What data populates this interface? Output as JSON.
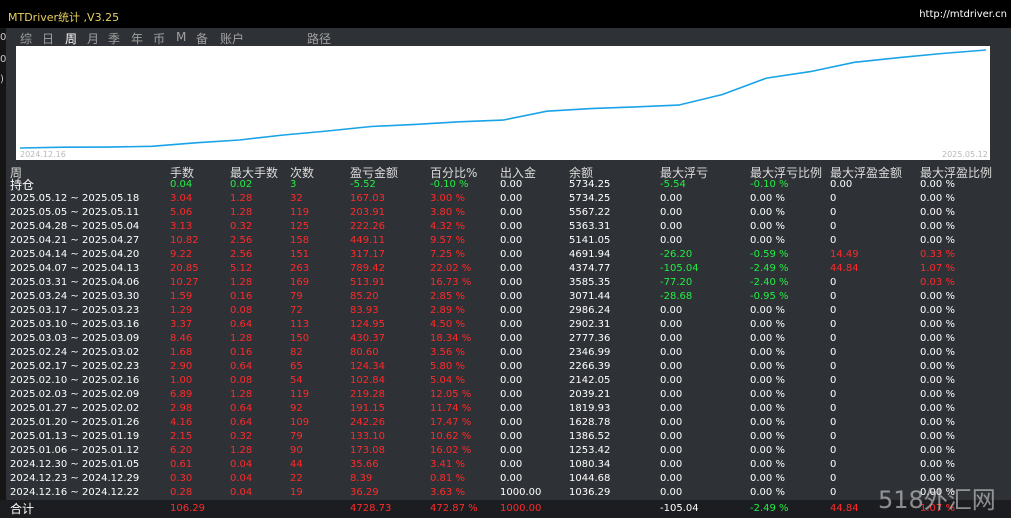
{
  "app": {
    "title": "MTDriver统计 ,V3.25",
    "url": "http://mtdriver.cn"
  },
  "tabs": [
    {
      "label": "综",
      "active": false
    },
    {
      "label": "日",
      "active": false
    },
    {
      "label": "周",
      "active": true
    },
    {
      "label": "月",
      "active": false
    },
    {
      "label": "季",
      "active": false
    },
    {
      "label": "年",
      "active": false
    },
    {
      "label": "币",
      "active": false
    },
    {
      "label": "M",
      "active": false
    },
    {
      "label": "备",
      "active": false
    },
    {
      "label": "账户",
      "active": false
    },
    {
      "label": "路径",
      "active": false
    }
  ],
  "chart": {
    "start_label": "2024.12.16",
    "end_label": "2025.05.12",
    "line_color": "#1aa3e8",
    "balance": [
      1000.0,
      1036.29,
      1044.68,
      1080.34,
      1253.42,
      1386.52,
      1628.78,
      1819.93,
      2039.21,
      2142.05,
      2266.39,
      2346.99,
      2777.36,
      2902.31,
      2986.24,
      3071.44,
      3585.35,
      4374.77,
      4691.94,
      5141.05,
      5363.31,
      5567.22,
      5734.25
    ]
  },
  "columns": [
    "周",
    "手数",
    "最大手数",
    "次数",
    "盈亏金额",
    "百分比%",
    "出入金",
    "余额",
    "最大浮亏",
    "最大浮亏比例",
    "最大浮盈金额",
    "最大浮盈比例"
  ],
  "holding": {
    "label": "持仓",
    "lots": "0.04",
    "max_lots": "0.02",
    "count": "3",
    "pnl": "-5.52",
    "pct": "-0.10 %",
    "deposit": "0.00",
    "balance": "5734.25",
    "max_float_loss": "-5.54",
    "max_float_loss_pct": "-0.10 %",
    "max_float_profit": "0.00",
    "max_float_profit_pct": "0.00 %"
  },
  "rows": [
    {
      "week": "2025.05.12 ~ 2025.05.18",
      "lots": "3.04",
      "max_lots": "1.28",
      "count": "32",
      "pnl": "167.03",
      "pct": "3.00 %",
      "deposit": "0.00",
      "balance": "5734.25",
      "max_float_loss": "0.00",
      "max_float_loss_pct": "0.00 %",
      "max_float_profit": "0",
      "max_float_profit_pct": "0.00 %"
    },
    {
      "week": "2025.05.05 ~ 2025.05.11",
      "lots": "5.06",
      "max_lots": "1.28",
      "count": "119",
      "pnl": "203.91",
      "pct": "3.80 %",
      "deposit": "0.00",
      "balance": "5567.22",
      "max_float_loss": "0.00",
      "max_float_loss_pct": "0.00 %",
      "max_float_profit": "0",
      "max_float_profit_pct": "0.00 %"
    },
    {
      "week": "2025.04.28 ~ 2025.05.04",
      "lots": "3.13",
      "max_lots": "0.32",
      "count": "125",
      "pnl": "222.26",
      "pct": "4.32 %",
      "deposit": "0.00",
      "balance": "5363.31",
      "max_float_loss": "0.00",
      "max_float_loss_pct": "0.00 %",
      "max_float_profit": "0",
      "max_float_profit_pct": "0.00 %"
    },
    {
      "week": "2025.04.21 ~ 2025.04.27",
      "lots": "10.82",
      "max_lots": "2.56",
      "count": "158",
      "pnl": "449.11",
      "pct": "9.57 %",
      "deposit": "0.00",
      "balance": "5141.05",
      "max_float_loss": "0.00",
      "max_float_loss_pct": "0.00 %",
      "max_float_profit": "0",
      "max_float_profit_pct": "0.00 %"
    },
    {
      "week": "2025.04.14 ~ 2025.04.20",
      "lots": "9.22",
      "max_lots": "2.56",
      "count": "151",
      "pnl": "317.17",
      "pct": "7.25 %",
      "deposit": "0.00",
      "balance": "4691.94",
      "max_float_loss": "-26.20",
      "max_float_loss_pct": "-0.59 %",
      "max_float_profit": "14.49",
      "max_float_profit_pct": "0.33 %"
    },
    {
      "week": "2025.04.07 ~ 2025.04.13",
      "lots": "20.85",
      "max_lots": "5.12",
      "count": "263",
      "pnl": "789.42",
      "pct": "22.02 %",
      "deposit": "0.00",
      "balance": "4374.77",
      "max_float_loss": "-105.04",
      "max_float_loss_pct": "-2.49 %",
      "max_float_profit": "44.84",
      "max_float_profit_pct": "1.07 %"
    },
    {
      "week": "2025.03.31 ~ 2025.04.06",
      "lots": "10.27",
      "max_lots": "1.28",
      "count": "169",
      "pnl": "513.91",
      "pct": "16.73 %",
      "deposit": "0.00",
      "balance": "3585.35",
      "max_float_loss": "-77.20",
      "max_float_loss_pct": "-2.40 %",
      "max_float_profit": "0",
      "max_float_profit_pct": "0.03 %"
    },
    {
      "week": "2025.03.24 ~ 2025.03.30",
      "lots": "1.59",
      "max_lots": "0.16",
      "count": "79",
      "pnl": "85.20",
      "pct": "2.85 %",
      "deposit": "0.00",
      "balance": "3071.44",
      "max_float_loss": "-28.68",
      "max_float_loss_pct": "-0.95 %",
      "max_float_profit": "0",
      "max_float_profit_pct": "0.00 %"
    },
    {
      "week": "2025.03.17 ~ 2025.03.23",
      "lots": "1.29",
      "max_lots": "0.08",
      "count": "72",
      "pnl": "83.93",
      "pct": "2.89 %",
      "deposit": "0.00",
      "balance": "2986.24",
      "max_float_loss": "0.00",
      "max_float_loss_pct": "0.00 %",
      "max_float_profit": "0",
      "max_float_profit_pct": "0.00 %"
    },
    {
      "week": "2025.03.10 ~ 2025.03.16",
      "lots": "3.37",
      "max_lots": "0.64",
      "count": "113",
      "pnl": "124.95",
      "pct": "4.50 %",
      "deposit": "0.00",
      "balance": "2902.31",
      "max_float_loss": "0.00",
      "max_float_loss_pct": "0.00 %",
      "max_float_profit": "0",
      "max_float_profit_pct": "0.00 %"
    },
    {
      "week": "2025.03.03 ~ 2025.03.09",
      "lots": "8.46",
      "max_lots": "1.28",
      "count": "150",
      "pnl": "430.37",
      "pct": "18.34 %",
      "deposit": "0.00",
      "balance": "2777.36",
      "max_float_loss": "0.00",
      "max_float_loss_pct": "0.00 %",
      "max_float_profit": "0",
      "max_float_profit_pct": "0.00 %"
    },
    {
      "week": "2025.02.24 ~ 2025.03.02",
      "lots": "1.68",
      "max_lots": "0.16",
      "count": "82",
      "pnl": "80.60",
      "pct": "3.56 %",
      "deposit": "0.00",
      "balance": "2346.99",
      "max_float_loss": "0.00",
      "max_float_loss_pct": "0.00 %",
      "max_float_profit": "0",
      "max_float_profit_pct": "0.00 %"
    },
    {
      "week": "2025.02.17 ~ 2025.02.23",
      "lots": "2.90",
      "max_lots": "0.64",
      "count": "65",
      "pnl": "124.34",
      "pct": "5.80 %",
      "deposit": "0.00",
      "balance": "2266.39",
      "max_float_loss": "0.00",
      "max_float_loss_pct": "0.00 %",
      "max_float_profit": "0",
      "max_float_profit_pct": "0.00 %"
    },
    {
      "week": "2025.02.10 ~ 2025.02.16",
      "lots": "1.00",
      "max_lots": "0.08",
      "count": "54",
      "pnl": "102.84",
      "pct": "5.04 %",
      "deposit": "0.00",
      "balance": "2142.05",
      "max_float_loss": "0.00",
      "max_float_loss_pct": "0.00 %",
      "max_float_profit": "0",
      "max_float_profit_pct": "0.00 %"
    },
    {
      "week": "2025.02.03 ~ 2025.02.09",
      "lots": "6.89",
      "max_lots": "1.28",
      "count": "119",
      "pnl": "219.28",
      "pct": "12.05 %",
      "deposit": "0.00",
      "balance": "2039.21",
      "max_float_loss": "0.00",
      "max_float_loss_pct": "0.00 %",
      "max_float_profit": "0",
      "max_float_profit_pct": "0.00 %"
    },
    {
      "week": "2025.01.27 ~ 2025.02.02",
      "lots": "2.98",
      "max_lots": "0.64",
      "count": "92",
      "pnl": "191.15",
      "pct": "11.74 %",
      "deposit": "0.00",
      "balance": "1819.93",
      "max_float_loss": "0.00",
      "max_float_loss_pct": "0.00 %",
      "max_float_profit": "0",
      "max_float_profit_pct": "0.00 %"
    },
    {
      "week": "2025.01.20 ~ 2025.01.26",
      "lots": "4.16",
      "max_lots": "0.64",
      "count": "109",
      "pnl": "242.26",
      "pct": "17.47 %",
      "deposit": "0.00",
      "balance": "1628.78",
      "max_float_loss": "0.00",
      "max_float_loss_pct": "0.00 %",
      "max_float_profit": "0",
      "max_float_profit_pct": "0.00 %"
    },
    {
      "week": "2025.01.13 ~ 2025.01.19",
      "lots": "2.15",
      "max_lots": "0.32",
      "count": "79",
      "pnl": "133.10",
      "pct": "10.62 %",
      "deposit": "0.00",
      "balance": "1386.52",
      "max_float_loss": "0.00",
      "max_float_loss_pct": "0.00 %",
      "max_float_profit": "0",
      "max_float_profit_pct": "0.00 %"
    },
    {
      "week": "2025.01.06 ~ 2025.01.12",
      "lots": "6.20",
      "max_lots": "1.28",
      "count": "90",
      "pnl": "173.08",
      "pct": "16.02 %",
      "deposit": "0.00",
      "balance": "1253.42",
      "max_float_loss": "0.00",
      "max_float_loss_pct": "0.00 %",
      "max_float_profit": "0",
      "max_float_profit_pct": "0.00 %"
    },
    {
      "week": "2024.12.30 ~ 2025.01.05",
      "lots": "0.61",
      "max_lots": "0.04",
      "count": "44",
      "pnl": "35.66",
      "pct": "3.41 %",
      "deposit": "0.00",
      "balance": "1080.34",
      "max_float_loss": "0.00",
      "max_float_loss_pct": "0.00 %",
      "max_float_profit": "0",
      "max_float_profit_pct": "0.00 %"
    },
    {
      "week": "2024.12.23 ~ 2024.12.29",
      "lots": "0.30",
      "max_lots": "0.04",
      "count": "22",
      "pnl": "8.39",
      "pct": "0.81 %",
      "deposit": "0.00",
      "balance": "1044.68",
      "max_float_loss": "0.00",
      "max_float_loss_pct": "0.00 %",
      "max_float_profit": "0",
      "max_float_profit_pct": "0.00 %"
    },
    {
      "week": "2024.12.16 ~ 2024.12.22",
      "lots": "0.28",
      "max_lots": "0.04",
      "count": "19",
      "pnl": "36.29",
      "pct": "3.63 %",
      "deposit": "1000.00",
      "balance": "1036.29",
      "max_float_loss": "0.00",
      "max_float_loss_pct": "0.00 %",
      "max_float_profit": "0",
      "max_float_profit_pct": "0.00 %"
    }
  ],
  "total": {
    "label": "合计",
    "lots": "106.29",
    "pnl": "4728.73",
    "pct": "472.87 %",
    "deposit": "1000.00",
    "max_float_loss": "-105.04",
    "max_float_loss_pct": "-2.49 %",
    "max_float_profit": "44.84",
    "max_float_profit_pct": "1.07 %"
  },
  "watermark": "518外汇网"
}
